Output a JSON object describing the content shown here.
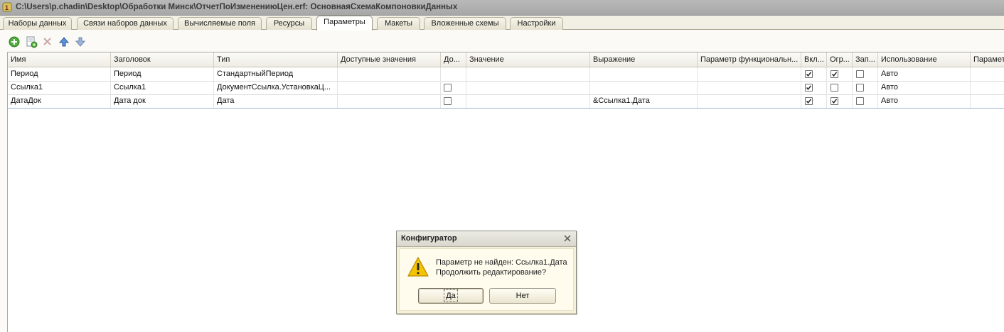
{
  "window": {
    "title": "C:\\Users\\p.chadin\\Desktop\\Обработки Минск\\ОтчетПоИзменениюЦен.erf: ОсновнаяСхемаКомпоновкиДанных"
  },
  "tabs": [
    {
      "label": "Наборы данных"
    },
    {
      "label": "Связи наборов данных"
    },
    {
      "label": "Вычисляемые поля"
    },
    {
      "label": "Ресурсы"
    },
    {
      "label": "Параметры"
    },
    {
      "label": "Макеты"
    },
    {
      "label": "Вложенные схемы"
    },
    {
      "label": "Настройки"
    }
  ],
  "active_tab": "Параметры",
  "toolbar": {
    "icons": [
      "add-icon",
      "add-copy-icon",
      "delete-icon",
      "move-up-icon",
      "move-down-icon"
    ]
  },
  "table": {
    "columns": [
      "Имя",
      "Заголовок",
      "Тип",
      "Доступные значения",
      "До...",
      "Значение",
      "Выражение",
      "Параметр функциональн...",
      "Вкл...",
      "Огр...",
      "Зап...",
      "Использование",
      "Парамет"
    ],
    "rows": [
      {
        "name": "Период",
        "title": "Период",
        "type": "СтандартныйПериод",
        "available": "",
        "list_checkbox": null,
        "value": "",
        "expression": "",
        "func_param": "",
        "include": true,
        "restrict": true,
        "fill": false,
        "usage": "Авто"
      },
      {
        "name": "Ссылка1",
        "title": "Ссылка1",
        "type": "ДокументСсылка.УстановкаЦ...",
        "available": "",
        "list_checkbox": false,
        "value": "",
        "expression": "",
        "func_param": "",
        "include": true,
        "restrict": false,
        "fill": false,
        "usage": "Авто"
      },
      {
        "name": "ДатаДок",
        "title": "Дата док",
        "type": "Дата",
        "available": "",
        "list_checkbox": false,
        "value": "",
        "expression": "&Ссылка1.Дата",
        "func_param": "",
        "include": true,
        "restrict": true,
        "fill": false,
        "usage": "Авто"
      }
    ]
  },
  "dialog": {
    "title": "Конфигуратор",
    "message_line1": "Параметр не найден: Ссылка1.Дата",
    "message_line2": "Продолжить редактирование?",
    "yes_label": "Да",
    "no_label": "Нет"
  },
  "colors": {
    "titlebar": "#b0b0b0",
    "panel": "#fbfaf6",
    "dialog": "#f5f0da",
    "warning": "#f5c400"
  }
}
